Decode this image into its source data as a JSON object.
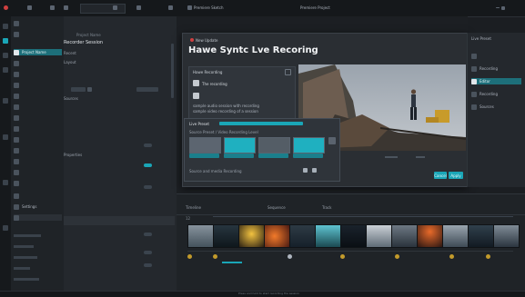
{
  "topbar": {
    "items": [
      "",
      "",
      "",
      "",
      "",
      "",
      "",
      "",
      "",
      "",
      "",
      ""
    ],
    "title": "Premiere Sketch",
    "right_title": "Premiere Project"
  },
  "left_panel": {
    "items": [
      {
        "label": ""
      },
      {
        "label": ""
      },
      {
        "label": "Project Name"
      },
      {
        "label": ""
      },
      {
        "label": ""
      },
      {
        "label": ""
      },
      {
        "label": ""
      },
      {
        "label": ""
      },
      {
        "label": ""
      },
      {
        "label": ""
      },
      {
        "label": ""
      },
      {
        "label": ""
      },
      {
        "label": ""
      },
      {
        "label": ""
      },
      {
        "label": ""
      },
      {
        "label": ""
      },
      {
        "label": "Settings"
      },
      {
        "label": ""
      }
    ]
  },
  "mid_panel": {
    "header": "Project Name",
    "sub": "Recorder Session",
    "props": [
      "Recent",
      "Layout",
      "",
      "Sources",
      "",
      "",
      "Properties",
      ""
    ]
  },
  "dialog": {
    "top_label": "New Update",
    "title": "Hawe Syntc Lve Recoring",
    "subcard_label": "Hawe Recording",
    "subcard_item": "The recording",
    "subcard_text1": "sample audio session with recording",
    "subcard_text2": "sample video recording of a session",
    "preset_label": "Live Preset",
    "preset_sub": "Source Preset / Video Recording Level",
    "footer_text": "Source and media Recording",
    "cancel_label": "Cancel",
    "ok_label": "Apply"
  },
  "right_panel": {
    "header": "Live Preset",
    "items": [
      {
        "label": ""
      },
      {
        "label": "Recording"
      },
      {
        "label": "Editor"
      },
      {
        "label": "Recording"
      },
      {
        "label": "Sources"
      }
    ]
  },
  "timeline": {
    "tabs": [
      "Timeline",
      "Sequence",
      "Track"
    ],
    "clip_count": "12"
  },
  "status": {
    "text": "Press and hold to start recording the session"
  }
}
